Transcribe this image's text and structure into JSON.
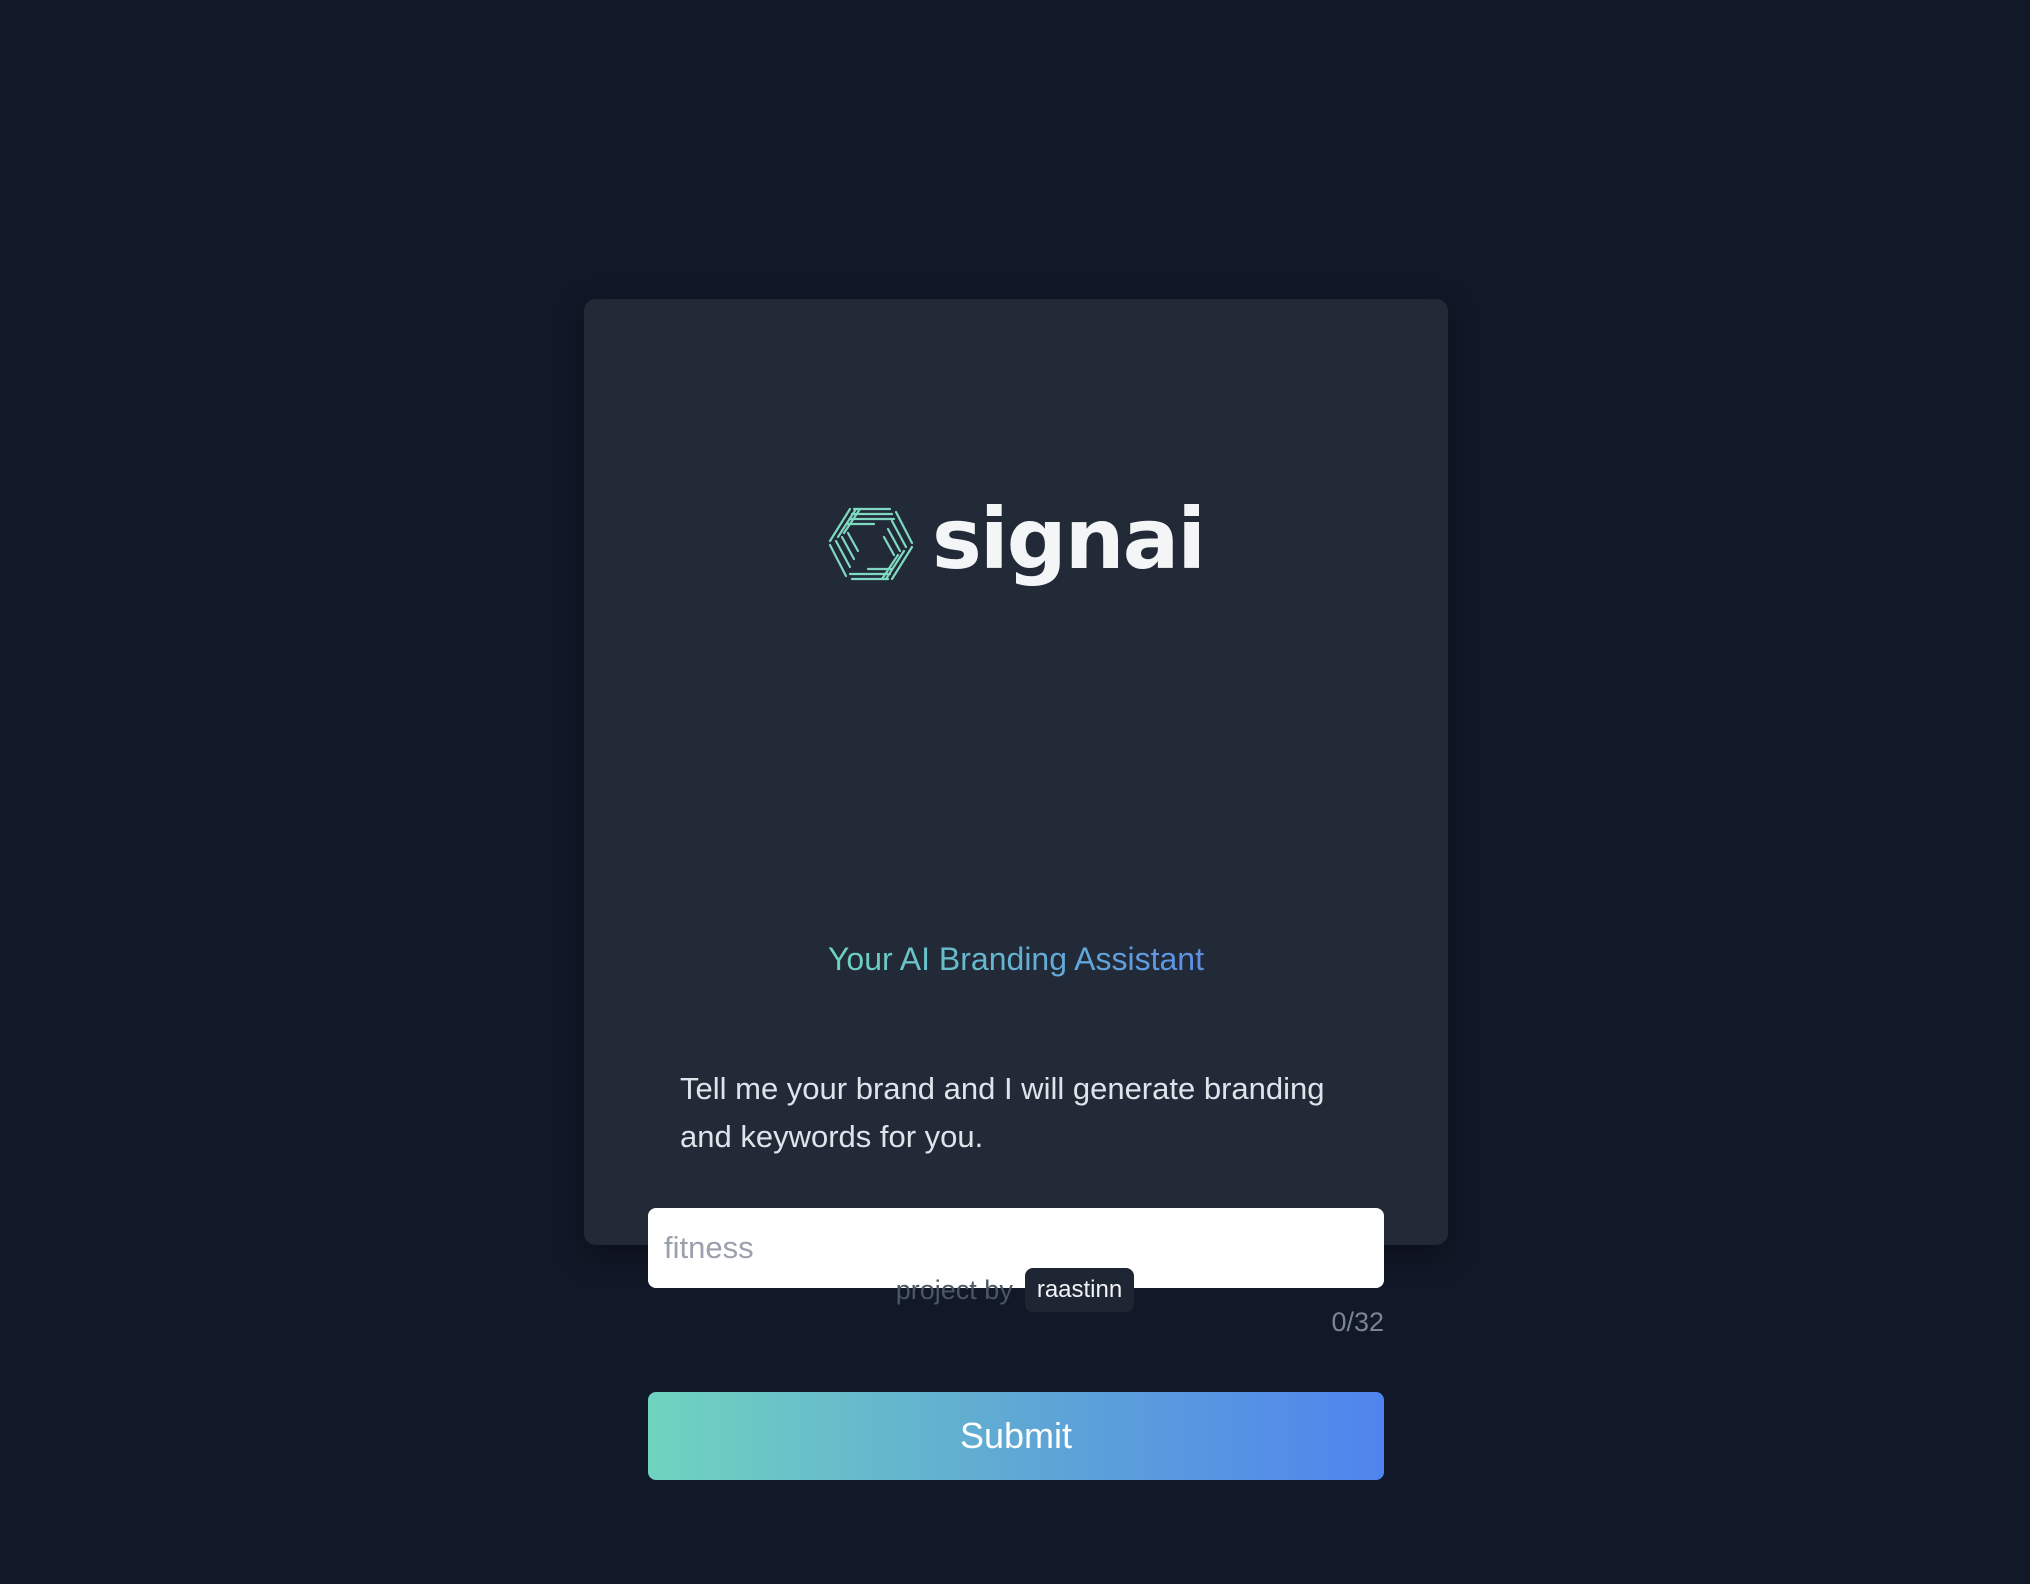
{
  "brand": {
    "name": "signai",
    "logo_icon": "hexagon-lines-logo-icon",
    "tagline": "Your AI Branding Assistant"
  },
  "form": {
    "description": "Tell me your brand and I will generate branding and keywords for you.",
    "input": {
      "placeholder": "fitness",
      "value": ""
    },
    "char_counter": "0/32",
    "submit_label": "Submit"
  },
  "footer": {
    "prefix": "project by",
    "author": "raastinn"
  },
  "colors": {
    "background": "#111827",
    "card": "#222a38",
    "accent_start": "#6fd3bf",
    "accent_end": "#4f84ee"
  }
}
